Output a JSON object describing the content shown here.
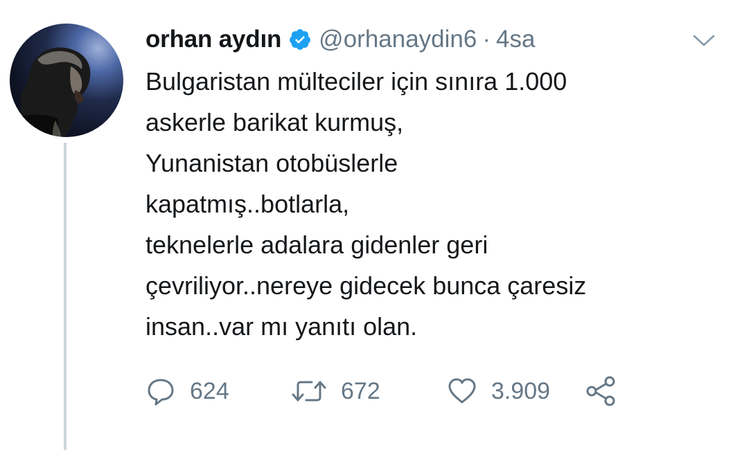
{
  "user": {
    "display_name": "orhan aydın",
    "handle": "@orhanaydin6",
    "separator": "·",
    "time": "4sa",
    "verified_icon": "verified-badge-icon",
    "avatar": "avatar"
  },
  "tweet": {
    "lines": [
      "Bulgaristan mülteciler için sınıra 1.000",
      "askerle barikat kurmuş,",
      "Yunanistan otobüslerle",
      "kapatmış..botlarla,",
      "teknelerle adalara gidenler geri",
      "çevriliyor..nereye gidecek bunca çaresiz",
      "insan..var mı yanıtı olan."
    ]
  },
  "actions": {
    "reply_count": "624",
    "retweet_count": "672",
    "like_count": "3.909",
    "icons": [
      "reply-icon",
      "retweet-icon",
      "like-icon",
      "share-icon",
      "chevron-down-icon"
    ]
  },
  "colors": {
    "text": "#14171a",
    "secondary": "#657786",
    "verified": "#1da1f2",
    "thread_line": "#ccd6dd"
  }
}
